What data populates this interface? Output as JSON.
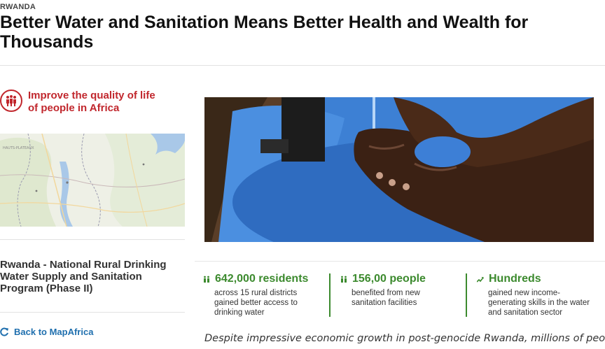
{
  "header": {
    "country": "RWANDA",
    "title": "Better Water and Sanitation Means Better Health and Wealth for Thousands"
  },
  "sidebar": {
    "goal": {
      "icon": "people-icon",
      "label": "Improve the quality of life of people in Africa"
    },
    "map": {
      "label": "HAUTS-PLATEAUX"
    },
    "project_title": "Rwanda - National Rural Drinking Water Supply and Sanitation Program (Phase II)",
    "back_link": {
      "icon": "refresh-arrow-icon",
      "label": "Back to MapAfrica"
    }
  },
  "stats": [
    {
      "icon": "people-icon",
      "value": "642,000 residents",
      "description": "across 15 rural districts gained better access to drinking water"
    },
    {
      "icon": "people-icon",
      "value": "156,00 people",
      "description": "benefited from new sanitation facilities"
    },
    {
      "icon": "growth-chart-icon",
      "value": "Hundreds",
      "description": "gained new income-generating skills in the water and sanitation sector"
    }
  ],
  "intro_text": "Despite impressive economic growth in post-genocide Rwanda, millions of people",
  "colors": {
    "accent_red": "#c1272d",
    "accent_green": "#3c8a2e",
    "link_blue": "#1f6fae"
  }
}
